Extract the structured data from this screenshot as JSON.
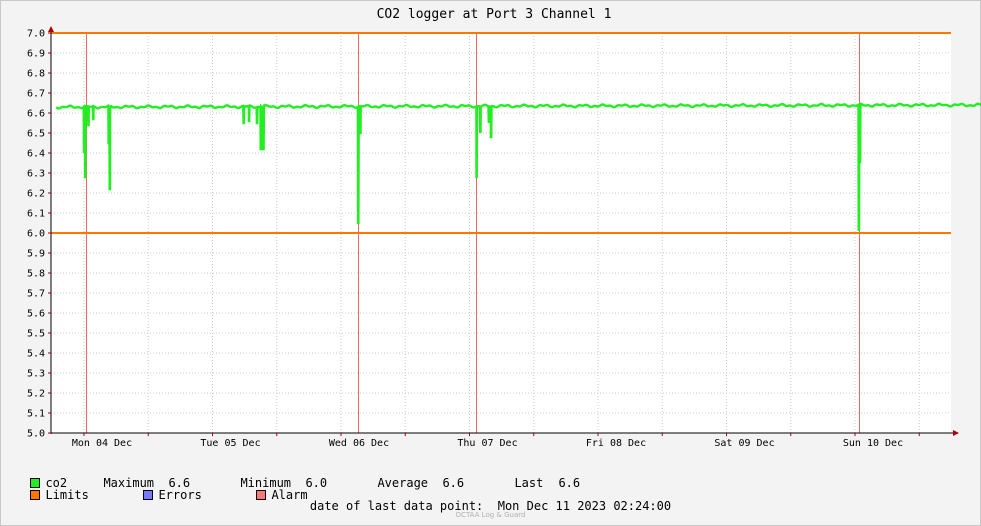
{
  "chart_data": {
    "type": "line",
    "title": "CO2 logger at Port 3 Channel 1",
    "ylim": [
      5.0,
      7.0
    ],
    "y_ticks": [
      "5.0",
      "5.1",
      "5.2",
      "5.3",
      "5.4",
      "5.5",
      "5.6",
      "5.7",
      "5.8",
      "5.9",
      "6.0",
      "6.1",
      "6.2",
      "6.3",
      "6.4",
      "6.5",
      "6.6",
      "6.7",
      "6.8",
      "6.9",
      "7.0"
    ],
    "x_tick_labels": [
      "Mon 04 Dec",
      "Tue 05 Dec",
      "Wed 06 Dec",
      "Thu 07 Dec",
      "Fri 08 Dec",
      "Sat 09 Dec",
      "Sun 10 Dec"
    ],
    "x_range_hours": [
      0,
      168
    ],
    "grid": true,
    "limits": {
      "upper": 7.0,
      "lower": 6.0
    },
    "alarm_markers_hours": [
      0.4,
      51.2,
      73.3,
      144.7
    ],
    "series": [
      {
        "name": "co2",
        "baseline": 6.63,
        "dips": [
          {
            "hours": 0.0,
            "value": 6.4
          },
          {
            "hours": 0.2,
            "value": 6.28
          },
          {
            "hours": 0.8,
            "value": 6.54
          },
          {
            "hours": 1.7,
            "value": 6.57
          },
          {
            "hours": 4.6,
            "value": 6.45
          },
          {
            "hours": 4.8,
            "value": 6.22
          },
          {
            "hours": 29.8,
            "value": 6.55
          },
          {
            "hours": 30.8,
            "value": 6.56
          },
          {
            "hours": 32.3,
            "value": 6.55
          },
          {
            "hours": 33.0,
            "value": 6.42
          },
          {
            "hours": 33.5,
            "value": 6.42
          },
          {
            "hours": 51.2,
            "value": 6.05
          },
          {
            "hours": 51.6,
            "value": 6.5
          },
          {
            "hours": 73.3,
            "value": 6.28
          },
          {
            "hours": 74.0,
            "value": 6.5
          },
          {
            "hours": 75.6,
            "value": 6.55
          },
          {
            "hours": 76.0,
            "value": 6.48
          },
          {
            "hours": 144.7,
            "value": 6.01
          },
          {
            "hours": 144.9,
            "value": 6.35
          }
        ]
      }
    ]
  },
  "legend": {
    "row1": {
      "co2_label": "co2",
      "max_label": "Maximum",
      "max_value": "6.6",
      "min_label": "Minimum",
      "min_value": "6.0",
      "avg_label": "Average",
      "avg_value": "6.6",
      "last_label": "Last",
      "last_value": "6.6"
    },
    "row2": {
      "limits_label": "Limits",
      "errors_label": "Errors",
      "alarm_label": "Alarm"
    }
  },
  "footer": {
    "date_label": "date of last data point:",
    "date_value": "Mon Dec 11 2023 02:24:00",
    "brand": "OCTAA Log & Guard"
  },
  "colors": {
    "series": "#22ee22",
    "limits": "#ff7700",
    "errors": "#7777ff",
    "alarm": "#ff7777",
    "grid": "#cccccc",
    "alarm_line": "#ee6666"
  }
}
